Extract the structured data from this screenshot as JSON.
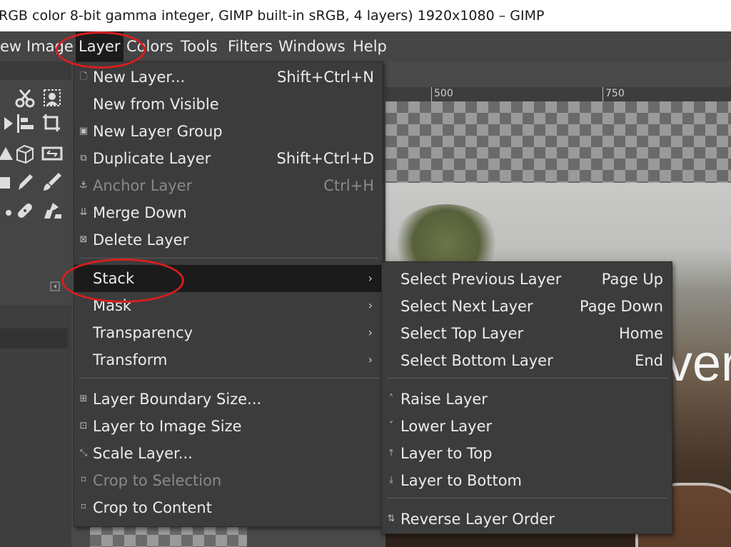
{
  "titlebar": {
    "text": "RGB color 8-bit gamma integer, GIMP built-in sRGB, 4 layers) 1920x1080 – GIMP"
  },
  "menubar": {
    "items": [
      "ew",
      "Image",
      "Layer",
      "Colors",
      "Tools",
      "Filters",
      "Windows",
      "Help"
    ],
    "active": "Layer"
  },
  "ruler": {
    "labels": [
      "500",
      "750"
    ]
  },
  "canvas": {
    "overlay_text": "ver"
  },
  "layer_menu": {
    "items": [
      {
        "label": "New Layer...",
        "shortcut": "Shift+Ctrl+N",
        "icon": "new-layer-icon"
      },
      {
        "label": "New from Visible",
        "shortcut": "",
        "icon": ""
      },
      {
        "label": "New Layer Group",
        "shortcut": "",
        "icon": "layer-group-icon"
      },
      {
        "label": "Duplicate Layer",
        "shortcut": "Shift+Ctrl+D",
        "icon": "duplicate-icon"
      },
      {
        "label": "Anchor Layer",
        "shortcut": "Ctrl+H",
        "icon": "anchor-icon",
        "disabled": true
      },
      {
        "label": "Merge Down",
        "shortcut": "",
        "icon": "merge-down-icon"
      },
      {
        "label": "Delete Layer",
        "shortcut": "",
        "icon": "delete-icon"
      },
      {
        "label": "Stack",
        "submenu": true,
        "highlighted": true
      },
      {
        "label": "Mask",
        "submenu": true
      },
      {
        "label": "Transparency",
        "submenu": true
      },
      {
        "label": "Transform",
        "submenu": true
      },
      {
        "label": "Layer Boundary Size...",
        "icon": "boundary-size-icon"
      },
      {
        "label": "Layer to Image Size",
        "icon": "to-image-size-icon"
      },
      {
        "label": "Scale Layer...",
        "icon": "scale-icon"
      },
      {
        "label": "Crop to Selection",
        "icon": "crop-icon",
        "disabled": true
      },
      {
        "label": "Crop to Content",
        "icon": "crop-icon"
      }
    ]
  },
  "stack_menu": {
    "items": [
      {
        "label": "Select Previous Layer",
        "shortcut": "Page Up"
      },
      {
        "label": "Select Next Layer",
        "shortcut": "Page Down"
      },
      {
        "label": "Select Top Layer",
        "shortcut": "Home"
      },
      {
        "label": "Select Bottom Layer",
        "shortcut": "End"
      },
      {
        "label": "Raise Layer",
        "icon": "raise-icon"
      },
      {
        "label": "Lower Layer",
        "icon": "lower-icon"
      },
      {
        "label": "Layer to Top",
        "icon": "to-top-icon"
      },
      {
        "label": "Layer to Bottom",
        "icon": "to-bottom-icon"
      },
      {
        "label": "Reverse Layer Order",
        "icon": "reverse-icon"
      }
    ]
  },
  "annotation_color": "#d81e1e"
}
